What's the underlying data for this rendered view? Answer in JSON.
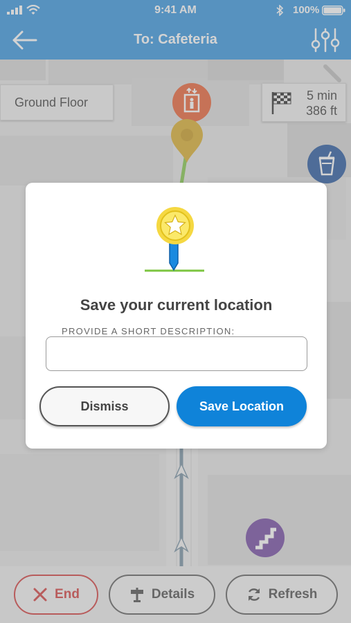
{
  "status_bar": {
    "time": "9:41 AM",
    "battery_percent": "100%",
    "icons": [
      "signal-icon",
      "wifi-icon",
      "bluetooth-icon",
      "battery-icon"
    ]
  },
  "nav": {
    "title": "To: Cafeteria",
    "back_icon": "arrow-left-icon",
    "filter_icon": "sliders-icon"
  },
  "map": {
    "floor_label": "Ground Floor",
    "eta_time": "5 min",
    "eta_distance": "386 ft",
    "poi_icons": [
      "elevator-icon",
      "destination-pin-icon",
      "drink-cup-icon",
      "stairs-icon",
      "route-arrow-icon"
    ],
    "colors": {
      "route": "#7cc540",
      "elevator": "#e8592a",
      "pin": "#e0b21c",
      "cafe": "#1a4f99",
      "stairs": "#6b3f9e"
    }
  },
  "dialog": {
    "heading": "Save your current location",
    "field_label": "PROVIDE A SHORT DESCRIPTION:",
    "field_value": "",
    "dismiss_label": "Dismiss",
    "save_label": "Save Location",
    "illustration_icon": "star-location-pin-icon"
  },
  "bottom_bar": {
    "end_label": "End",
    "details_label": "Details",
    "refresh_label": "Refresh"
  },
  "colors": {
    "brand": "#2a8fdc",
    "primary_button": "#0f83d9",
    "danger": "#d03232"
  }
}
